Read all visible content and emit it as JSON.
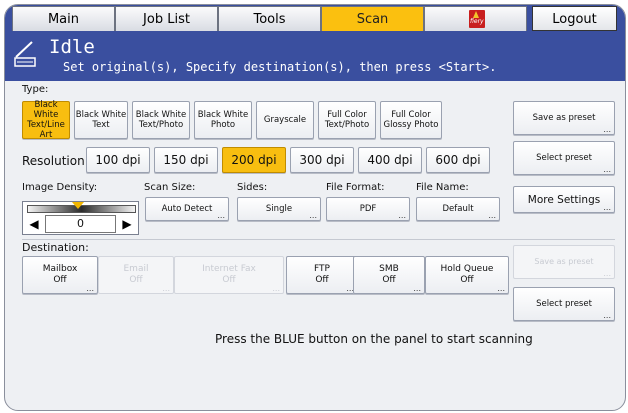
{
  "tabs": [
    {
      "label": "Main"
    },
    {
      "label": "Job List"
    },
    {
      "label": "Tools"
    },
    {
      "label": "Scan"
    },
    {
      "label": "fiery"
    },
    {
      "label": "Logout"
    }
  ],
  "header": {
    "title": "Idle",
    "subtitle": "Set original(s), Specify destination(s), then press <Start>."
  },
  "type": {
    "label": "Type:",
    "options": [
      "Black White Text/Line Art",
      "Black White Text",
      "Black White Text/Photo",
      "Black White Photo",
      "Grayscale",
      "Full Color Text/Photo",
      "Full Color Glossy Photo"
    ],
    "selected": "Black White Text/Line Art"
  },
  "resolution": {
    "label": "Resolution:",
    "options": [
      "100 dpi",
      "150 dpi",
      "200 dpi",
      "300 dpi",
      "400 dpi",
      "600 dpi"
    ],
    "selected": "200 dpi"
  },
  "image_density": {
    "label": "Image Density:",
    "value": "0"
  },
  "scan_size": {
    "label": "Scan Size:",
    "value": "Auto Detect"
  },
  "sides": {
    "label": "Sides:",
    "value": "Single"
  },
  "file_format": {
    "label": "File Format:",
    "value": "PDF"
  },
  "file_name": {
    "label": "File Name:",
    "value": "Default"
  },
  "right_panel": {
    "save_preset": "Save as preset",
    "select_preset": "Select preset",
    "more_settings": "More Settings",
    "save_preset_dest": "Save as preset",
    "select_preset_dest": "Select preset"
  },
  "destination": {
    "label": "Destination:",
    "items": [
      {
        "name": "Mailbox",
        "state": "Off",
        "enabled": true
      },
      {
        "name": "Email",
        "state": "Off",
        "enabled": false
      },
      {
        "name": "Internet Fax",
        "state": "Off",
        "enabled": false
      },
      {
        "name": "FTP",
        "state": "Off",
        "enabled": true
      },
      {
        "name": "SMB",
        "state": "Off",
        "enabled": true
      },
      {
        "name": "Hold Queue",
        "state": "Off",
        "enabled": true
      }
    ]
  },
  "status_message": "Press the BLUE button on the panel to start scanning",
  "colors": {
    "accent_blue": "#3a4f9f",
    "selected_yellow": "#f8be10",
    "fiery_red": "#c81e1e"
  }
}
